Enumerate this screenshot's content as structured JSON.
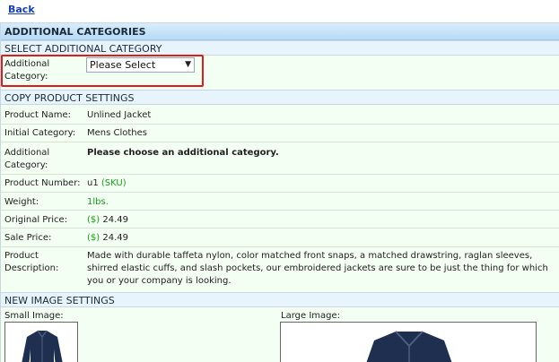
{
  "nav": {
    "back_label": "Back"
  },
  "page": {
    "title": "ADDITIONAL CATEGORIES"
  },
  "select_section": {
    "header": "SELECT ADDITIONAL CATEGORY",
    "label": "Additional Category:",
    "select_value": "Please Select"
  },
  "copy_section": {
    "header": "COPY PRODUCT SETTINGS",
    "rows": {
      "product_name": {
        "label": "Product Name:",
        "value": "Unlined Jacket"
      },
      "initial_category": {
        "label": "Initial Category:",
        "value": "Mens Clothes"
      },
      "additional_category": {
        "label": "Additional Category:",
        "value": "Please choose an additional category."
      },
      "product_number": {
        "label": "Product Number:",
        "value": "u1",
        "suffix": "(SKU)"
      },
      "weight": {
        "label": "Weight:",
        "value": "1lbs."
      },
      "original_price": {
        "label": "Original Price:",
        "currency": "($)",
        "value": "24.49"
      },
      "sale_price": {
        "label": "Sale Price:",
        "currency": "($)",
        "value": "24.49"
      },
      "description": {
        "label": "Product Description:",
        "value": "Made with durable taffeta nylon, color matched front snaps, a matched drawstring, raglan sleeves, shirred elastic cuffs, and slash pockets, our embroidered jackets are sure to be just the thing for which you or your company is looking."
      }
    }
  },
  "image_section": {
    "header": "NEW IMAGE SETTINGS",
    "small_label": "Small Image:",
    "large_label": "Large Image:"
  },
  "colors": {
    "accent_red": "#e01b1b",
    "price_green": "#1a9b1a",
    "header_blue": "#b7dbf6"
  }
}
